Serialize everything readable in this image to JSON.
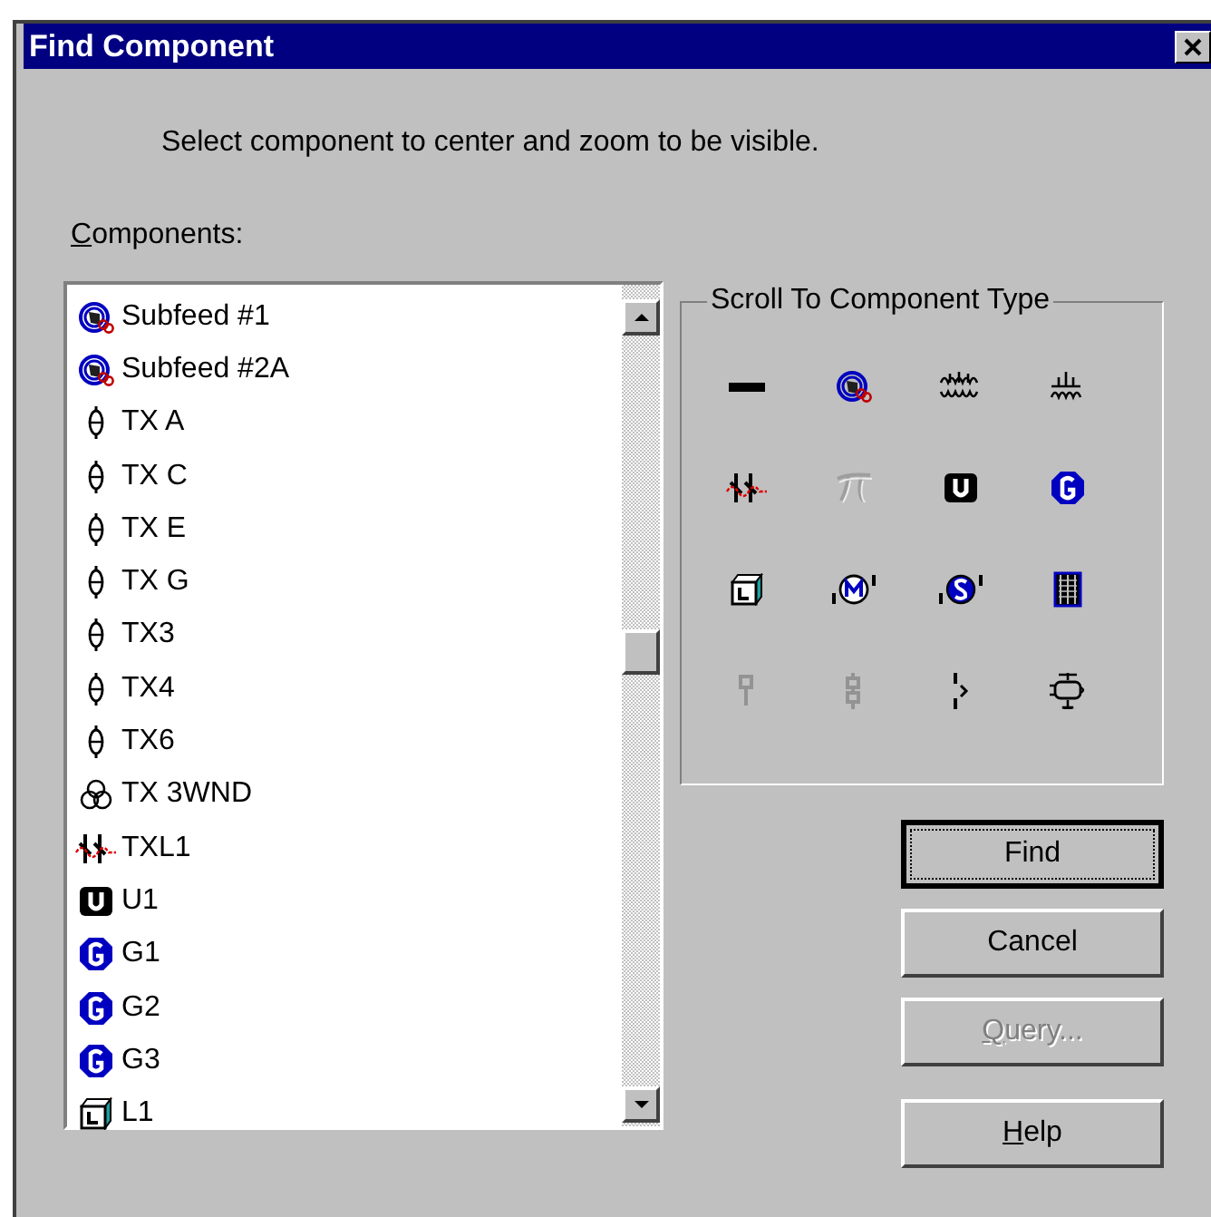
{
  "window": {
    "title": "Find Component"
  },
  "instruction": "Select component to center and zoom to be visible.",
  "components_label": {
    "text": "Components:",
    "mnemonic": true
  },
  "components": [
    {
      "label": "Subfeed #1",
      "kind": "subfeed"
    },
    {
      "label": "Subfeed #2A",
      "kind": "subfeed"
    },
    {
      "label": "TX A",
      "kind": "tx"
    },
    {
      "label": "TX C",
      "kind": "tx"
    },
    {
      "label": "TX E",
      "kind": "tx"
    },
    {
      "label": "TX G",
      "kind": "tx"
    },
    {
      "label": "TX3",
      "kind": "tx"
    },
    {
      "label": "TX4",
      "kind": "tx"
    },
    {
      "label": "TX6",
      "kind": "tx"
    },
    {
      "label": "TX 3WND",
      "kind": "tx3"
    },
    {
      "label": "TXL1",
      "kind": "txl"
    },
    {
      "label": "U1",
      "kind": "utility"
    },
    {
      "label": "G1",
      "kind": "generator"
    },
    {
      "label": "G2",
      "kind": "generator"
    },
    {
      "label": "G3",
      "kind": "generator"
    },
    {
      "label": "L1",
      "kind": "load"
    }
  ],
  "type_group": {
    "title": "Scroll To Component Type",
    "types": [
      {
        "kind": "bus",
        "disabled": false
      },
      {
        "kind": "subfeed",
        "disabled": false
      },
      {
        "kind": "coil2",
        "disabled": false
      },
      {
        "kind": "coil1",
        "disabled": false
      },
      {
        "kind": "txl",
        "disabled": false
      },
      {
        "kind": "pi",
        "disabled": true
      },
      {
        "kind": "utility",
        "disabled": false
      },
      {
        "kind": "generator",
        "disabled": false
      },
      {
        "kind": "load",
        "disabled": false
      },
      {
        "kind": "motor",
        "disabled": false
      },
      {
        "kind": "smotor",
        "disabled": false
      },
      {
        "kind": "panel",
        "disabled": false
      },
      {
        "kind": "pin",
        "disabled": true
      },
      {
        "kind": "link",
        "disabled": true
      },
      {
        "kind": "breaker",
        "disabled": false
      },
      {
        "kind": "capacitor",
        "disabled": false
      }
    ]
  },
  "buttons": [
    {
      "label": "Find",
      "default": true,
      "disabled": false,
      "mnemonic": false
    },
    {
      "label": "Cancel",
      "default": false,
      "disabled": false,
      "mnemonic": false
    },
    {
      "label": "Query...",
      "default": false,
      "disabled": true,
      "mnemonic": true
    },
    {
      "label": "Help",
      "default": false,
      "disabled": false,
      "mnemonic": true
    }
  ]
}
